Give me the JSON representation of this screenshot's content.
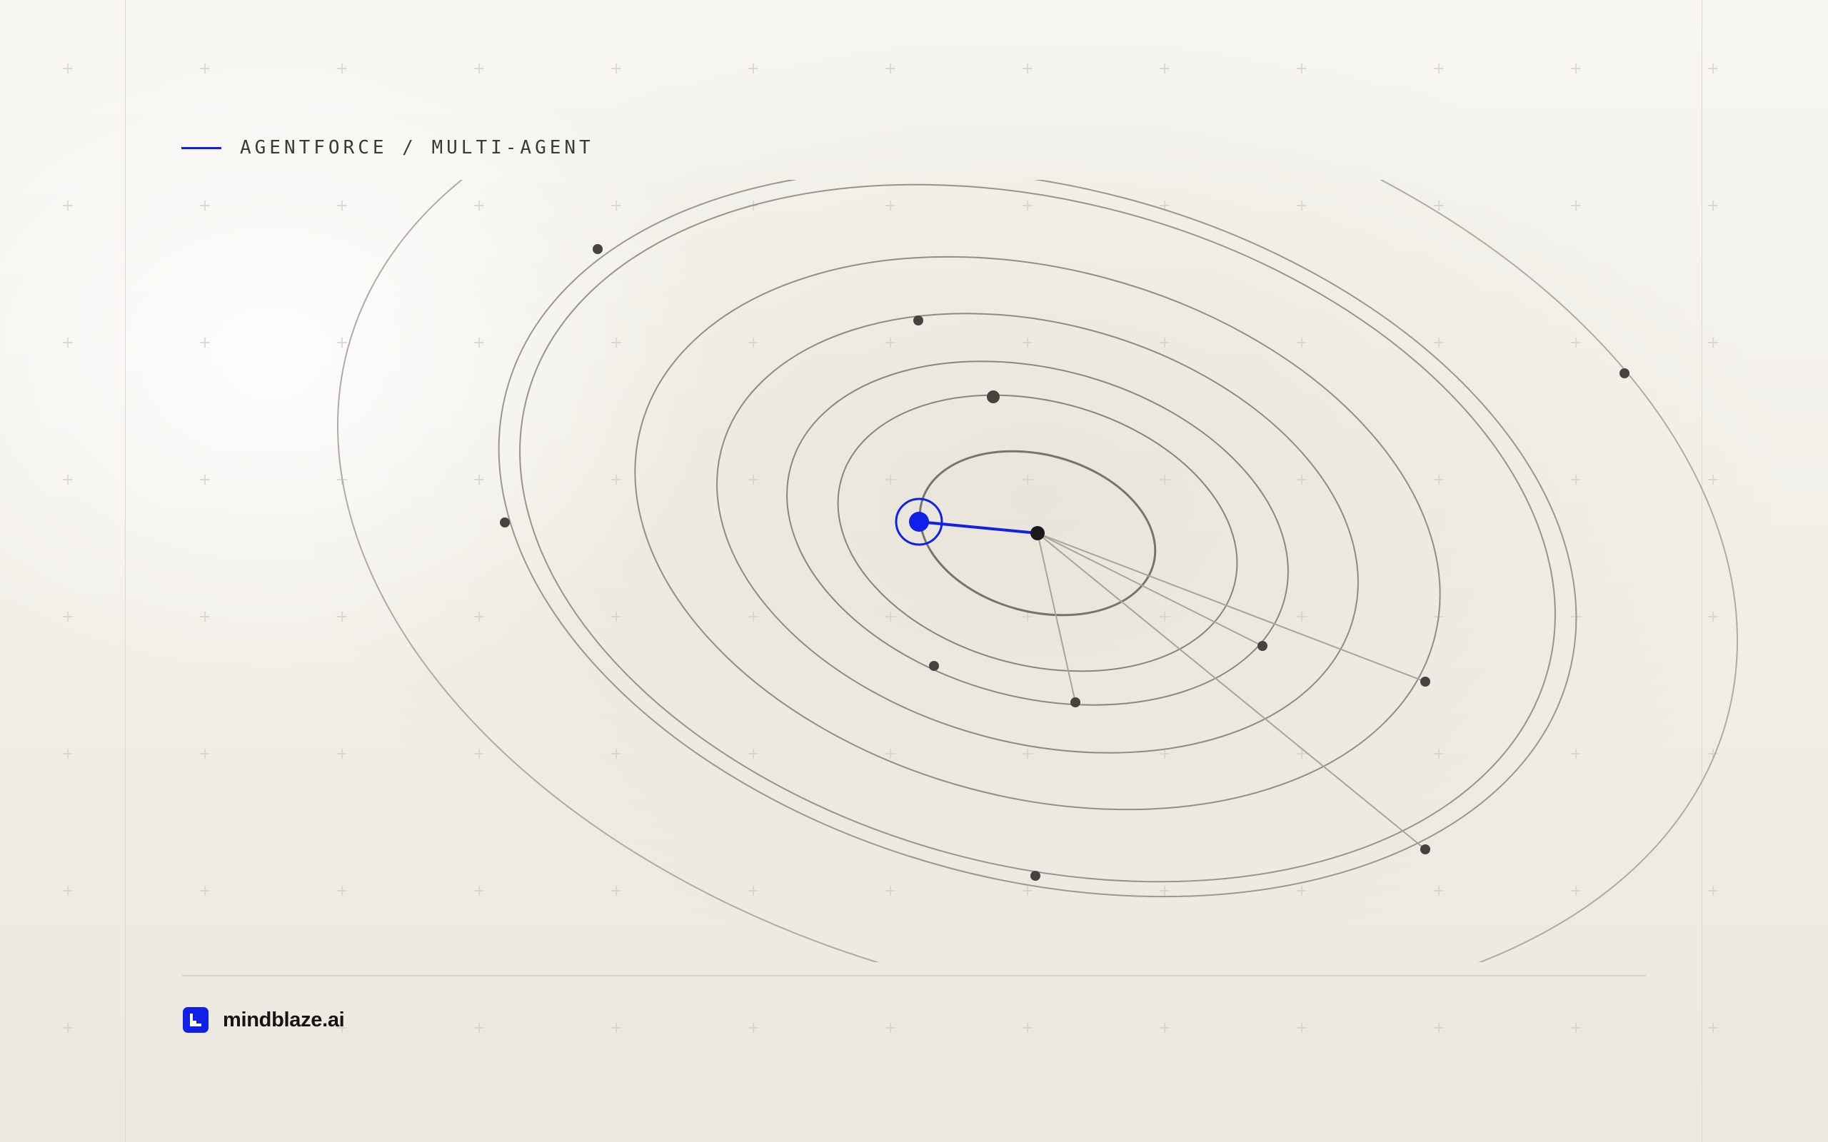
{
  "header": {
    "title": "AGENTFORCE / MULTI-AGENT"
  },
  "brand": {
    "name": "mindblaze.ai",
    "logo_icon": "stairs-logo-icon"
  },
  "colors": {
    "accent": "#1020E8",
    "orbit_stroke": "#8a8781",
    "node_fill": "#45433f",
    "core_fill": "#1a1a1a",
    "background": "#efebe2"
  },
  "diagram": {
    "description_nodes": "central hub node connected to highlighted agent node and to peripheral agent nodes on concentric orbits",
    "orbit_count": 8,
    "agent_node_count": 12,
    "highlighted_agent_count": 1
  }
}
